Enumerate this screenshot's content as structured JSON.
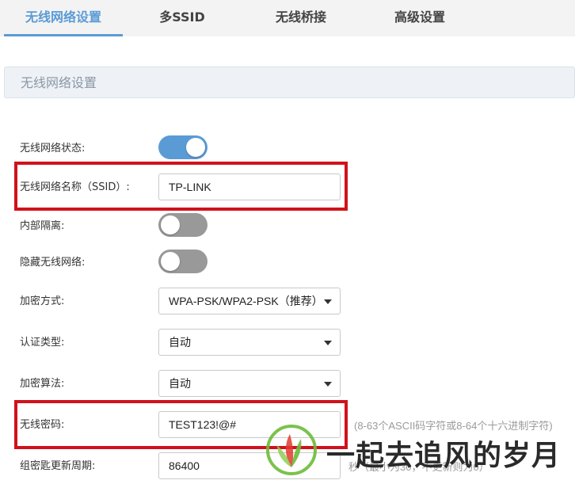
{
  "tabs": [
    {
      "label": "无线网络设置",
      "active": true
    },
    {
      "label": "多SSID",
      "active": false
    },
    {
      "label": "无线桥接",
      "active": false
    },
    {
      "label": "高级设置",
      "active": false
    }
  ],
  "section": {
    "title": "无线网络设置"
  },
  "form": {
    "wireless_status": {
      "label": "无线网络状态:",
      "on": true
    },
    "ssid": {
      "label": "无线网络名称（SSID）:",
      "value": "TP-LINK"
    },
    "isolation": {
      "label": "内部隔离:",
      "on": false
    },
    "hide_ssid": {
      "label": "隐藏无线网络:",
      "on": false
    },
    "encryption": {
      "label": "加密方式:",
      "value": "WPA-PSK/WPA2-PSK（推荐）"
    },
    "auth_type": {
      "label": "认证类型:",
      "value": "自动"
    },
    "algorithm": {
      "label": "加密算法:",
      "value": "自动"
    },
    "password": {
      "label": "无线密码:",
      "value": "TEST123!@#",
      "hint": "(8-63个ASCII码字符或8-64个十六进制字符)"
    },
    "rekey": {
      "label": "组密匙更新周期:",
      "value": "86400",
      "hint": "秒（最小为30，不更新则为0）"
    }
  },
  "watermark": {
    "text": "一起去追风的岁月",
    "icon": "leaf-logo-icon"
  },
  "colors": {
    "accent": "#5b9bd5",
    "highlight": "#d0121b"
  }
}
